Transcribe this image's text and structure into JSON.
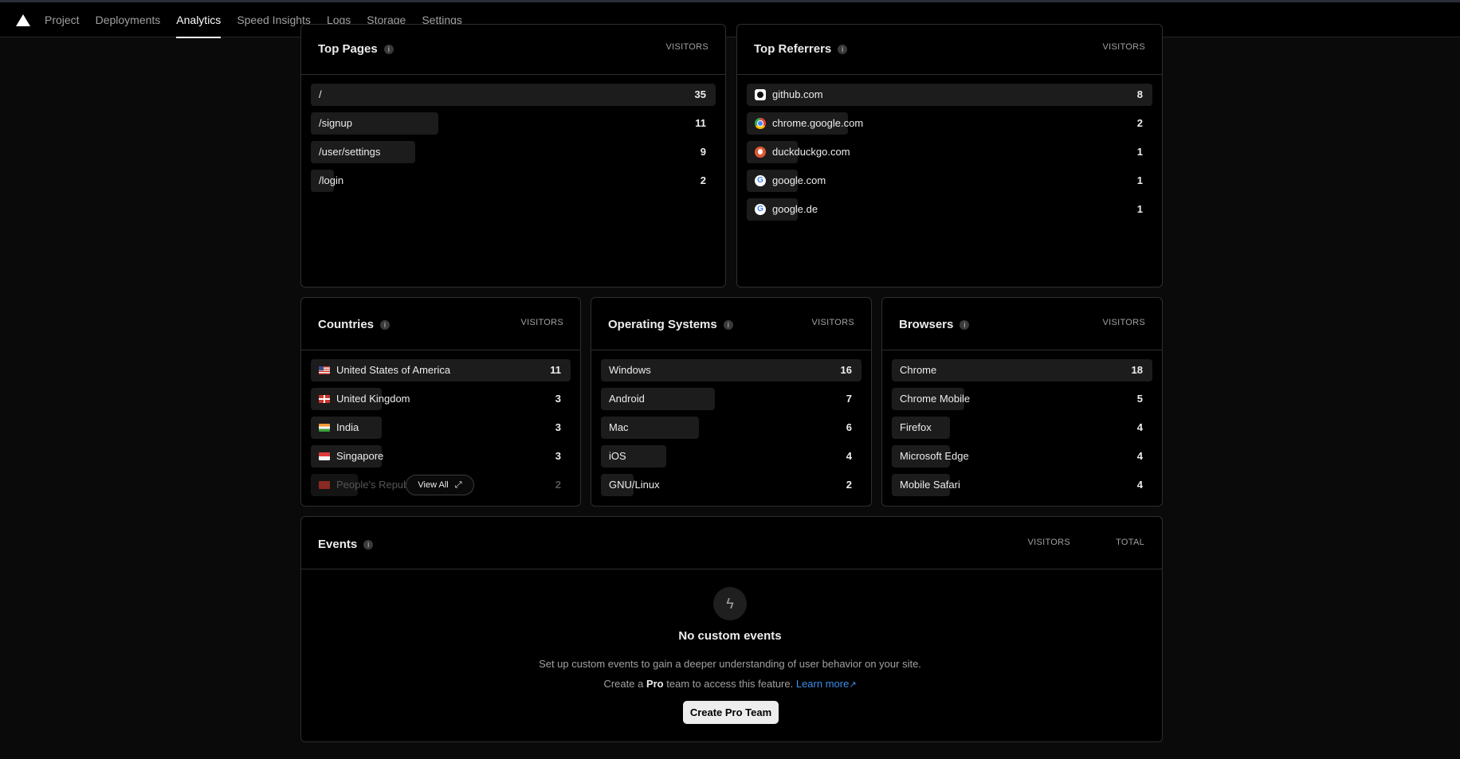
{
  "nav": {
    "items": [
      "Project",
      "Deployments",
      "Analytics",
      "Speed Insights",
      "Logs",
      "Storage",
      "Settings"
    ],
    "active": "Analytics"
  },
  "top_pages": {
    "title": "Top Pages",
    "col": "VISITORS",
    "rows": [
      {
        "label": "/",
        "value": "35",
        "share": 1.0
      },
      {
        "label": "/signup",
        "value": "11",
        "share": 0.314
      },
      {
        "label": "/user/settings",
        "value": "9",
        "share": 0.257
      },
      {
        "label": "/login",
        "value": "2",
        "share": 0.057
      }
    ]
  },
  "top_referrers": {
    "title": "Top Referrers",
    "col": "VISITORS",
    "rows": [
      {
        "label": "github.com",
        "value": "8",
        "share": 1.0,
        "icon": "github-favicon"
      },
      {
        "label": "chrome.google.com",
        "value": "2",
        "share": 0.25,
        "icon": "chrome-favicon"
      },
      {
        "label": "duckduckgo.com",
        "value": "1",
        "share": 0.125,
        "icon": "duckduckgo-favicon"
      },
      {
        "label": "google.com",
        "value": "1",
        "share": 0.125,
        "icon": "google-favicon"
      },
      {
        "label": "google.de",
        "value": "1",
        "share": 0.125,
        "icon": "google-favicon"
      }
    ]
  },
  "countries": {
    "title": "Countries",
    "col": "VISITORS",
    "rows": [
      {
        "label": "United States of America",
        "value": "11",
        "share": 1.0,
        "icon": "us-flag"
      },
      {
        "label": "United Kingdom",
        "value": "3",
        "share": 0.273,
        "icon": "uk-flag"
      },
      {
        "label": "India",
        "value": "3",
        "share": 0.273,
        "icon": "india-flag"
      },
      {
        "label": "Singapore",
        "value": "3",
        "share": 0.273,
        "icon": "singapore-flag"
      },
      {
        "label": "People's Repub",
        "value": "2",
        "share": 0.182,
        "icon": "china-flag"
      }
    ],
    "view_all": "View All"
  },
  "operating_systems": {
    "title": "Operating Systems",
    "col": "VISITORS",
    "rows": [
      {
        "label": "Windows",
        "value": "16",
        "share": 1.0
      },
      {
        "label": "Android",
        "value": "7",
        "share": 0.4375
      },
      {
        "label": "Mac",
        "value": "6",
        "share": 0.375
      },
      {
        "label": "iOS",
        "value": "4",
        "share": 0.25
      },
      {
        "label": "GNU/Linux",
        "value": "2",
        "share": 0.125
      }
    ]
  },
  "browsers": {
    "title": "Browsers",
    "col": "VISITORS",
    "rows": [
      {
        "label": "Chrome",
        "value": "18",
        "share": 1.0
      },
      {
        "label": "Chrome Mobile",
        "value": "5",
        "share": 0.278
      },
      {
        "label": "Firefox",
        "value": "4",
        "share": 0.222
      },
      {
        "label": "Microsoft Edge",
        "value": "4",
        "share": 0.222
      },
      {
        "label": "Mobile Safari",
        "value": "4",
        "share": 0.222
      }
    ]
  },
  "events": {
    "title": "Events",
    "col_visitors": "VISITORS",
    "col_total": "TOTAL",
    "empty_title": "No custom events",
    "empty_desc": "Set up custom events to gain a deeper understanding of user behavior on your site.",
    "pro_prefix": "Create a",
    "pro_word": "Pro",
    "pro_suffix": "team to access this feature.",
    "learn_more": "Learn more",
    "button": "Create Pro Team"
  },
  "colors": {
    "accent_link": "#3b8eea",
    "bar": "#1c1c1c",
    "background": "#0a0a0a"
  }
}
